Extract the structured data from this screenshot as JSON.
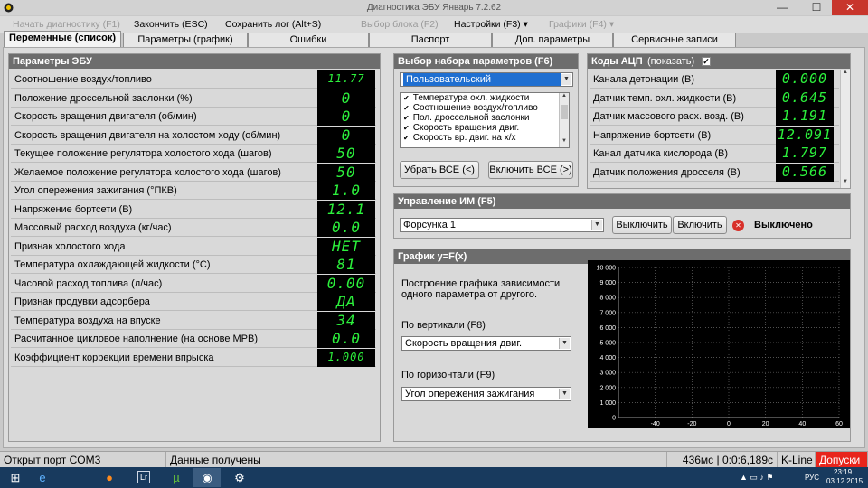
{
  "window": {
    "title": "Диагностика ЭБУ Январь 7.2.62",
    "controls": {
      "minimize": "—",
      "maximize": "☐",
      "close": "✕"
    }
  },
  "menu": [
    {
      "label": "Начать диагностику (F1)",
      "disabled": true
    },
    {
      "label": "Закончить (ESC)",
      "disabled": false
    },
    {
      "label": "Сохранить лог (Alt+S)",
      "disabled": false
    },
    {
      "label": "Выбор блока (F2)",
      "disabled": true
    },
    {
      "label": "Настройки (F3) ▾",
      "disabled": false
    },
    {
      "label": "Графики (F4) ▾",
      "disabled": true
    }
  ],
  "tabs": [
    {
      "label": "Переменные (список)",
      "active": true
    },
    {
      "label": "Параметры (график)",
      "active": false
    },
    {
      "label": "Ошибки",
      "active": false
    },
    {
      "label": "Паспорт",
      "active": false
    },
    {
      "label": "Доп. параметры",
      "active": false
    },
    {
      "label": "Сервисные записи",
      "active": false
    }
  ],
  "ecu_params": {
    "title": "Параметры ЭБУ",
    "rows": [
      {
        "label": "Соотношение воздух/топливо",
        "value": "11.77"
      },
      {
        "label": "Положение дроссельной заслонки (%)",
        "value": "0"
      },
      {
        "label": "Скорость вращения двигателя (об/мин)",
        "value": "0"
      },
      {
        "label": "Скорость вращения двигателя на холостом ходу (об/мин)",
        "value": "0"
      },
      {
        "label": "Текущее положение регулятора холостого хода (шагов)",
        "value": "50"
      },
      {
        "label": "Желаемое положение регулятора холостого хода (шагов)",
        "value": "50"
      },
      {
        "label": "Угол опережения зажигания (°ПКВ)",
        "value": "1.0"
      },
      {
        "label": "Напряжение бортсети (В)",
        "value": "12.1"
      },
      {
        "label": "Массовый расход воздуха (кг/час)",
        "value": "0.0"
      },
      {
        "label": "Признак холостого хода",
        "value": "НЕТ"
      },
      {
        "label": "Температура охлаждающей жидкости (°С)",
        "value": "81"
      },
      {
        "label": "Часовой расход топлива (л/час)",
        "value": "0.00"
      },
      {
        "label": "Признак продувки адсорбера",
        "value": "ДА"
      },
      {
        "label": "Температура воздуха на впуске",
        "value": "34"
      },
      {
        "label": "Расчитанное цикловое наполнение (на основе МРВ)",
        "value": "0.0"
      },
      {
        "label": "Коэффициент коррекции времени впрыска",
        "value": "1.000"
      }
    ]
  },
  "param_set": {
    "title": "Выбор набора параметров (F6)",
    "selected": "Пользовательский",
    "checklist": [
      "Температура охл. жидкости",
      "Соотношение воздух/топливо",
      "Пол. дроссельной заслонки",
      "Скорость вращения двиг.",
      "Скорость вр. двиг. на х/х"
    ],
    "btn_clear": "Убрать ВСЕ (<)",
    "btn_all": "Включить ВСЕ (>)"
  },
  "adc": {
    "title": "Коды АЦП",
    "show_label": "(показать)",
    "show_checked": "✓",
    "rows": [
      {
        "label": "Канала детонации (В)",
        "value": "0.000"
      },
      {
        "label": "Датчик темп. охл. жидкости (В)",
        "value": "0.645"
      },
      {
        "label": "Датчик массового расх. возд. (В)",
        "value": "1.191"
      },
      {
        "label": "Напряжение бортсети (В)",
        "value": "12.091"
      },
      {
        "label": "Канал датчика кислорода (В)",
        "value": "1.797"
      },
      {
        "label": "Датчик положения дросселя (В)",
        "value": "0.566"
      }
    ]
  },
  "im_control": {
    "title": "Управление ИМ (F5)",
    "selected": "Форсунка 1",
    "btn_off": "Выключить",
    "btn_on": "Включить",
    "status": "Выключено",
    "status_icon": "✕"
  },
  "graph": {
    "title": "График y=F(x)",
    "description_line1": "Построение графика зависимости",
    "description_line2": "одного параметра от другого.",
    "vertical_label": "По вертикали (F8)",
    "vertical_value": "Скорость вращения двиг.",
    "horizontal_label": "По горизонтали (F9)",
    "horizontal_value": "Угол опережения зажигания"
  },
  "chart_data": {
    "type": "scatter",
    "x": [],
    "y": [],
    "xlim": [
      -60,
      60
    ],
    "ylim": [
      0,
      10000
    ],
    "xticks": [
      "-40",
      "-20",
      "0",
      "20",
      "40",
      "60"
    ],
    "yticks": [
      "10 000",
      "9 000",
      "8 000",
      "7 000",
      "6 000",
      "5 000",
      "4 000",
      "3 000",
      "2 000",
      "1 000",
      "0"
    ],
    "grid": true
  },
  "status": {
    "port": "Открыт порт COM3",
    "data": "Данные получены",
    "timing": "436мс | 0:0:6,189с",
    "protocol": "K-Line",
    "alert": "Допуски"
  },
  "taskbar": {
    "lang": "РУС",
    "time": "23:19",
    "date": "03.12.2015",
    "apps": [
      "start-icon",
      "ie-icon",
      "firefox-icon",
      "lightroom-icon",
      "utorrent-icon",
      "diag-app-icon",
      "tool-icon"
    ]
  },
  "colors": {
    "lcd_fg": "#2cf03c",
    "alert_bg": "#e8251c",
    "highlight": "#1f6fd1"
  }
}
